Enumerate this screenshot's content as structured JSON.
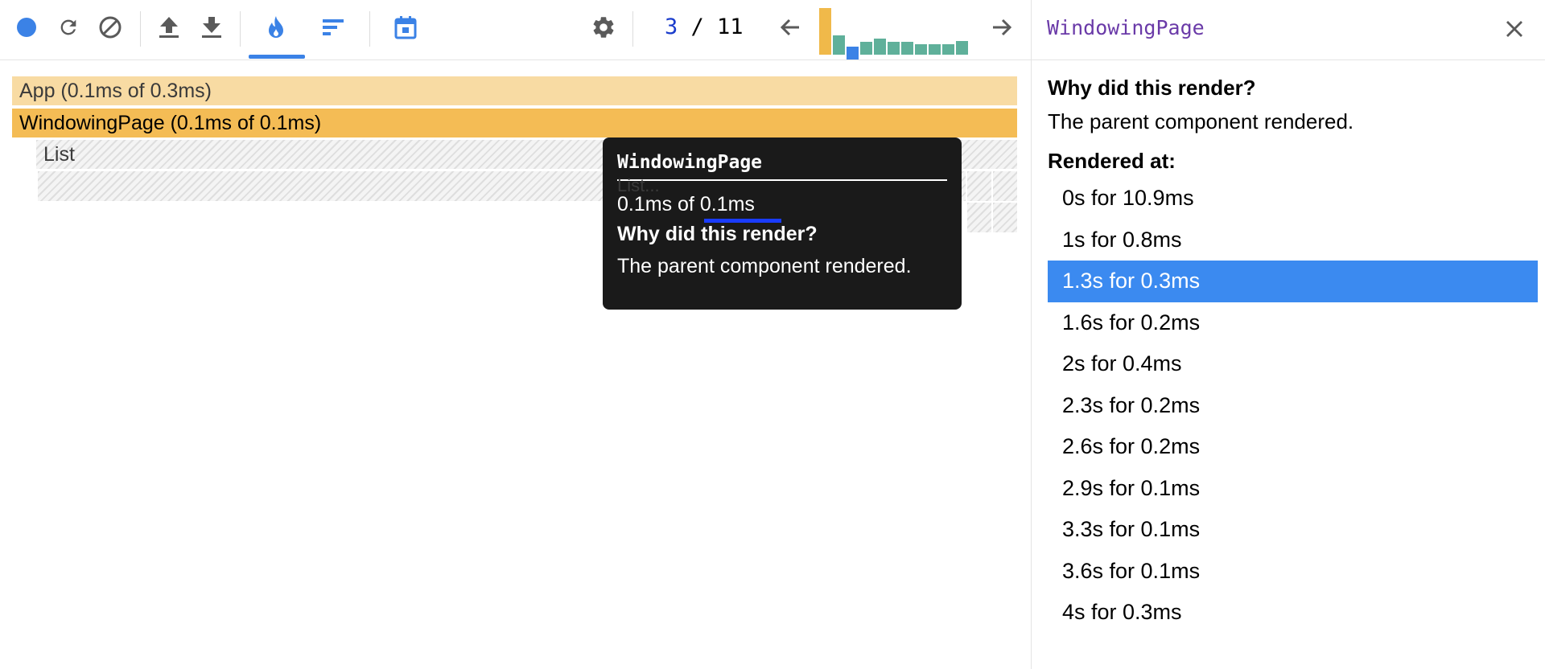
{
  "toolbar": {
    "commit_current": "3",
    "commit_separator": " / ",
    "commit_total": "11",
    "commit_bars": [
      {
        "value": 1.0,
        "color": "#f0b94a"
      },
      {
        "value": 0.42,
        "color": "#5fb09a"
      },
      {
        "value": 0.28,
        "color": "#3b82e6"
      },
      {
        "value": 0.28,
        "color": "#5fb09a"
      },
      {
        "value": 0.34,
        "color": "#5fb09a"
      },
      {
        "value": 0.28,
        "color": "#5fb09a"
      },
      {
        "value": 0.28,
        "color": "#5fb09a"
      },
      {
        "value": 0.22,
        "color": "#5fb09a"
      },
      {
        "value": 0.22,
        "color": "#5fb09a"
      },
      {
        "value": 0.22,
        "color": "#5fb09a"
      },
      {
        "value": 0.3,
        "color": "#5fb09a"
      }
    ],
    "colors": {
      "accent": "#3b82e6",
      "icon": "#5a5a5a"
    }
  },
  "flame": {
    "app_label": "App (0.1ms of 0.3ms)",
    "windowing_label": "WindowingPage (0.1ms of 0.1ms)",
    "list_label": "List",
    "colors": {
      "app": "#f8dba3",
      "windowing": "#f4bc55"
    }
  },
  "tooltip": {
    "title": "WindowingPage",
    "ghost_text": "List...",
    "time_prefix": "0.1ms of ",
    "time_total": "0.1ms",
    "why_heading": "Why did this render?",
    "reason": "The parent component rendered."
  },
  "sidebar": {
    "title": "WindowingPage",
    "why_heading": "Why did this render?",
    "reason": "The parent component rendered.",
    "rendered_at_heading": "Rendered at:",
    "selected_index": 2,
    "rendered_at": [
      "0s for 10.9ms",
      "1s for 0.8ms",
      "1.3s for 0.3ms",
      "1.6s for 0.2ms",
      "2s for 0.4ms",
      "2.3s for 0.2ms",
      "2.6s for 0.2ms",
      "2.9s for 0.1ms",
      "3.3s for 0.1ms",
      "3.6s for 0.1ms",
      "4s for 0.3ms"
    ]
  }
}
